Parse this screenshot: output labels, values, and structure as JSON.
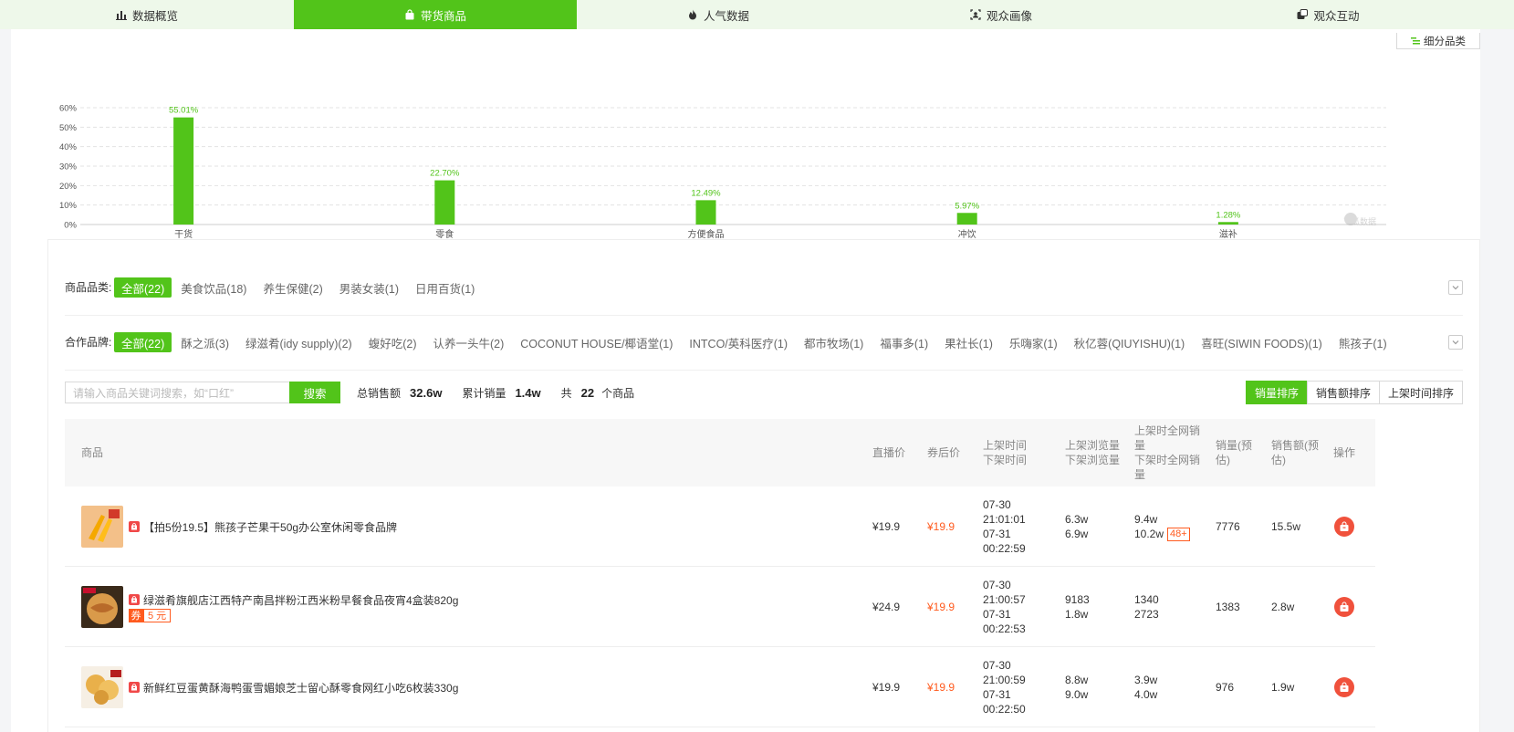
{
  "tabs": [
    {
      "label": "数据概览",
      "icon": "bar-chart-icon"
    },
    {
      "label": "带货商品",
      "icon": "shopping-bag-icon",
      "active": true
    },
    {
      "label": "人气数据",
      "icon": "fire-icon"
    },
    {
      "label": "观众画像",
      "icon": "portrait-icon"
    },
    {
      "label": "观众互动",
      "icon": "interaction-icon"
    }
  ],
  "subcategory_button": "细分品类",
  "watermark": "飞瓜数据",
  "chart_data": {
    "type": "bar",
    "categories": [
      "干货",
      "零食",
      "方便食品",
      "冲饮",
      "滋补"
    ],
    "values": [
      55.01,
      22.7,
      12.49,
      5.97,
      1.28
    ],
    "data_labels": [
      "55.01%",
      "22.70%",
      "12.49%",
      "5.97%",
      "1.28%"
    ],
    "yticks": [
      "0%",
      "10%",
      "20%",
      "30%",
      "40%",
      "50%",
      "60%"
    ],
    "ylim": [
      0,
      60
    ],
    "grid": true,
    "color": "#52c41a"
  },
  "filters": {
    "category": {
      "label": "商品品类:",
      "options": [
        "全部(22)",
        "美食饮品(18)",
        "养生保健(2)",
        "男装女装(1)",
        "日用百货(1)"
      ]
    },
    "brand": {
      "label": "合作品牌:",
      "options": [
        "全部(22)",
        "酥之派(3)",
        "绿滋肴(idy supply)(2)",
        "蝮好吃(2)",
        "认养一头牛(2)",
        "COCONUT HOUSE/椰语堂(1)",
        "INTCO/英科医疗(1)",
        "都市牧场(1)",
        "福事多(1)",
        "果社长(1)",
        "乐嗨家(1)",
        "秋亿蓉(QIUYISHU)(1)",
        "喜旺(SIWIN FOODS)(1)",
        "熊孩子(1)"
      ]
    }
  },
  "search": {
    "placeholder": "请输入商品关键词搜索，如“口红”",
    "button": "搜索"
  },
  "stats": {
    "total_sales_label": "总销售额",
    "total_sales": "32.6w",
    "cum_volume_label": "累计销量",
    "cum_volume": "1.4w",
    "count_prefix": "共",
    "count": "22",
    "count_suffix": "个商品"
  },
  "sort": [
    "销量排序",
    "销售额排序",
    "上架时间排序"
  ],
  "table": {
    "headers": {
      "product": "商品",
      "live_price": "直播价",
      "after_coupon": "券后价",
      "time": [
        "上架时间",
        "下架时间"
      ],
      "views": [
        "上架浏览量",
        "下架浏览量"
      ],
      "web_sales": [
        "上架时全网销",
        "量",
        "下架时全网销",
        "量"
      ],
      "volume": [
        "销量(预",
        "估)"
      ],
      "amount": [
        "销售额(预",
        "估)"
      ],
      "op": "操作"
    },
    "rows": [
      {
        "name": "【拍5份19.5】熊孩子芒果干50g办公室休闲零食品牌",
        "coupon": "",
        "live_price": "¥19.9",
        "after_coupon": "¥19.9",
        "on_date": "07-30",
        "on_time": "21:01:01",
        "off_date": "07-31",
        "off_time": "00:22:59",
        "on_views": "6.3w",
        "off_views": "6.9w",
        "on_web": "9.4w",
        "off_web": "10.2w",
        "badge": "48+",
        "volume": "7776",
        "amount": "15.5w",
        "thumb": "mango"
      },
      {
        "name": "绿滋肴旗舰店江西特产南昌拌粉江西米粉早餐食品夜宵4盒装820g",
        "coupon": "5 元",
        "coupon_tag": "券",
        "live_price": "¥24.9",
        "after_coupon": "¥19.9",
        "on_date": "07-30",
        "on_time": "21:00:57",
        "off_date": "07-31",
        "off_time": "00:22:53",
        "on_views": "9183",
        "off_views": "1.8w",
        "on_web": "1340",
        "off_web": "2723",
        "badge": "",
        "volume": "1383",
        "amount": "2.8w",
        "thumb": "noodle"
      },
      {
        "name": "新鲜红豆蛋黄酥海鸭蛋雪媚娘芝士留心酥零食网红小吃6枚装330g",
        "coupon": "",
        "live_price": "¥19.9",
        "after_coupon": "¥19.9",
        "on_date": "07-30",
        "on_time": "21:00:59",
        "off_date": "07-31",
        "off_time": "00:22:50",
        "on_views": "8.8w",
        "off_views": "9.0w",
        "on_web": "3.9w",
        "off_web": "4.0w",
        "badge": "",
        "volume": "976",
        "amount": "1.9w",
        "thumb": "pastry"
      }
    ]
  }
}
